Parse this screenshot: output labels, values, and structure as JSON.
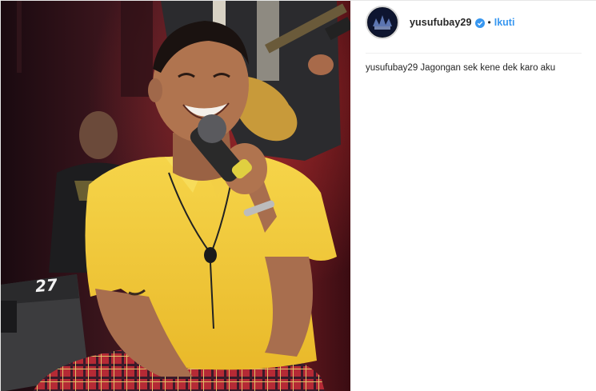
{
  "post": {
    "photo": {
      "description_icon": "photo",
      "speaker_number": "27"
    },
    "header": {
      "avatar_icon": "avatar",
      "username": "yusufubay29",
      "verified_icon": "verified-badge-icon",
      "separator": "•",
      "follow_label": "Ikuti"
    },
    "caption": {
      "username": "yusufubay29",
      "text": "Jagongan sek kene dek karo aku"
    }
  },
  "colors": {
    "follow": "#3897f0",
    "text": "#262626",
    "shirt": "#f2c93a",
    "stage_bg": "#2a0d12"
  }
}
